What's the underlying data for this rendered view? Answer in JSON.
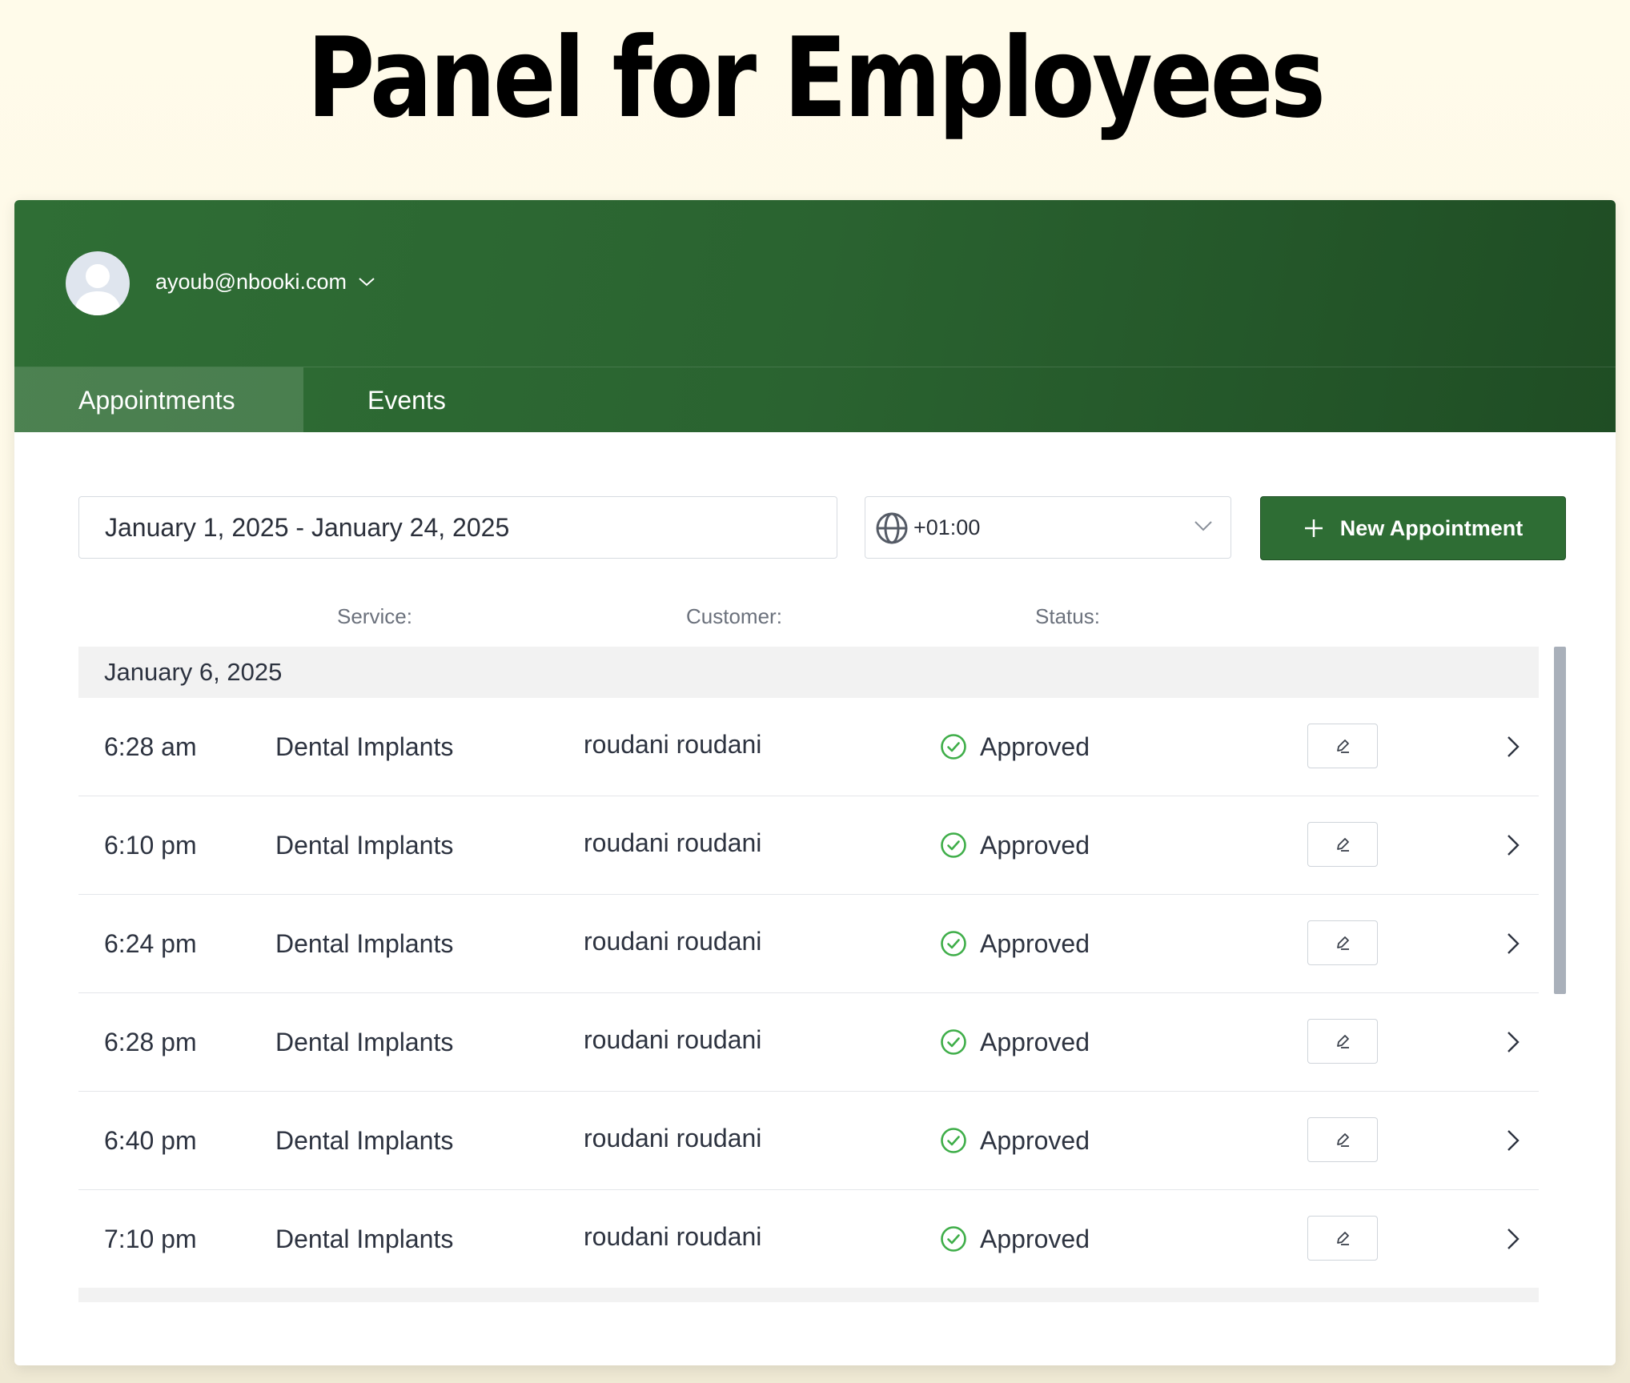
{
  "page": {
    "title": "Panel for Employees"
  },
  "header": {
    "user_email": "ayoub@nbooki.com"
  },
  "tabs": [
    {
      "label": "Appointments",
      "active": true
    },
    {
      "label": "Events",
      "active": false
    }
  ],
  "toolbar": {
    "date_range": "January 1, 2025 - January 24, 2025",
    "timezone": "+01:00",
    "new_appointment_label": "New Appointment"
  },
  "columns": {
    "service": "Service:",
    "customer": "Customer:",
    "status": "Status:"
  },
  "group": {
    "date": "January 6, 2025"
  },
  "appointments": [
    {
      "time": "6:28 am",
      "service": "Dental Implants",
      "customer": "roudani roudani",
      "status": "Approved"
    },
    {
      "time": "6:10 pm",
      "service": "Dental Implants",
      "customer": "roudani roudani",
      "status": "Approved"
    },
    {
      "time": "6:24 pm",
      "service": "Dental Implants",
      "customer": "roudani roudani",
      "status": "Approved"
    },
    {
      "time": "6:28 pm",
      "service": "Dental Implants",
      "customer": "roudani roudani",
      "status": "Approved"
    },
    {
      "time": "6:40 pm",
      "service": "Dental Implants",
      "customer": "roudani roudani",
      "status": "Approved"
    },
    {
      "time": "7:10 pm",
      "service": "Dental Implants",
      "customer": "roudani roudani",
      "status": "Approved"
    }
  ],
  "colors": {
    "brand_green": "#2e6d34",
    "approved_green": "#3fae49"
  }
}
